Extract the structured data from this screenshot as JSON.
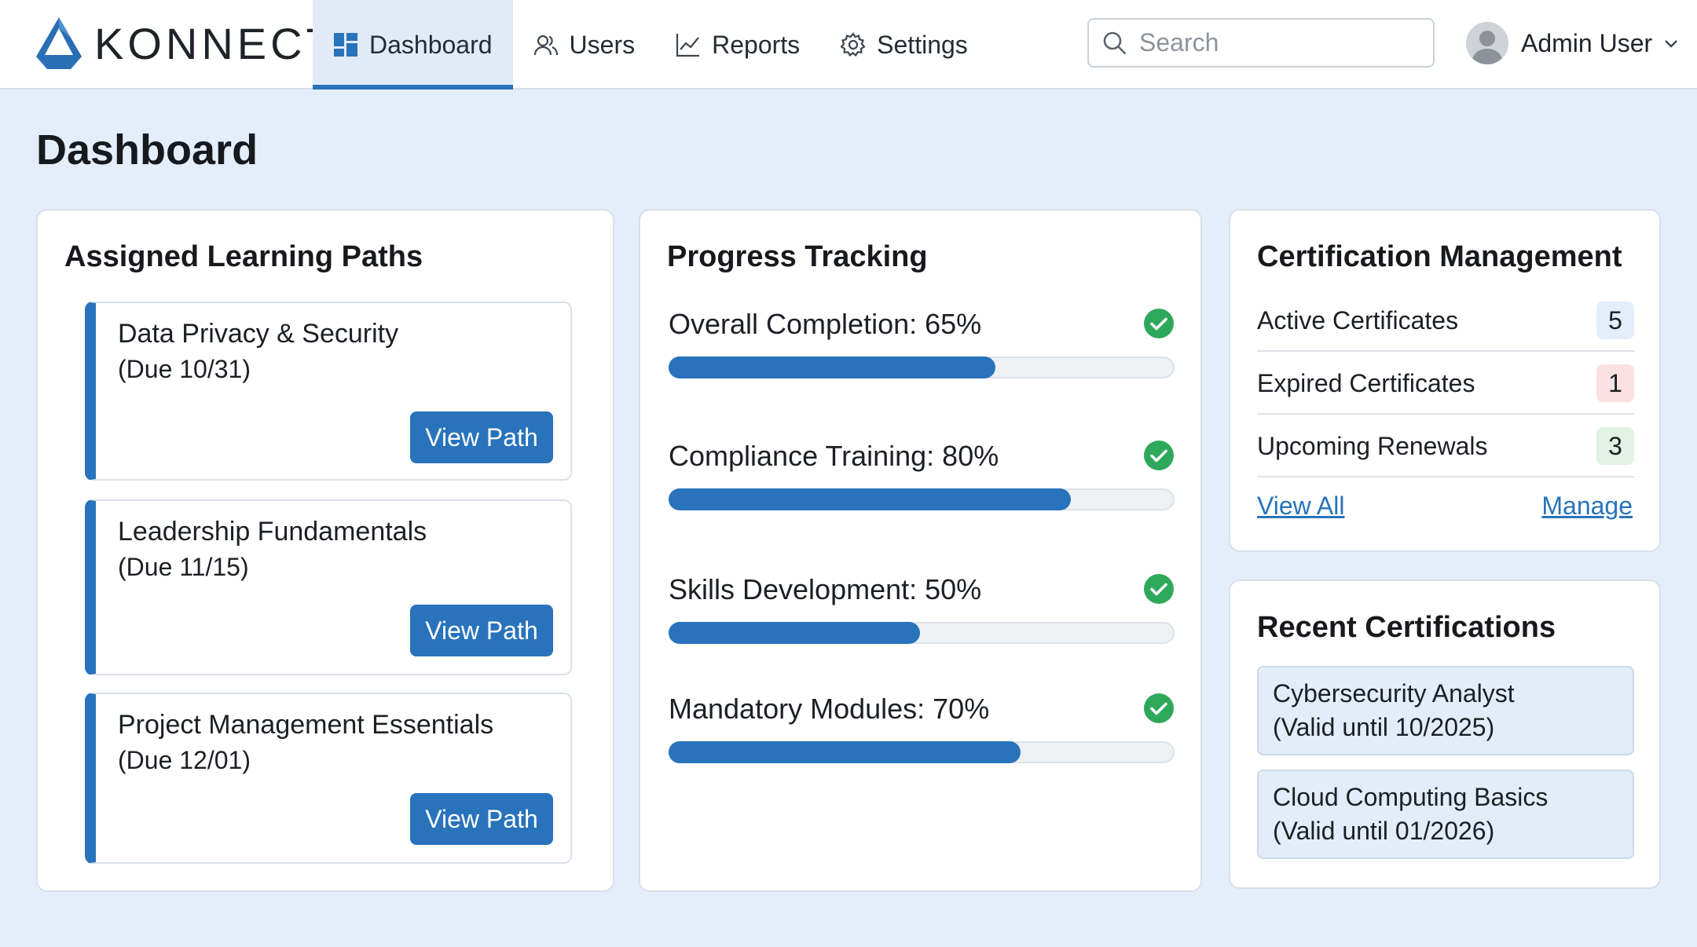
{
  "brand": {
    "name": "KONNECT"
  },
  "nav": {
    "items": [
      {
        "label": "Dashboard",
        "icon": "grid-icon",
        "active": true
      },
      {
        "label": "Users",
        "icon": "users-icon",
        "active": false
      },
      {
        "label": "Reports",
        "icon": "chart-line-icon",
        "active": false
      },
      {
        "label": "Settings",
        "icon": "gear-icon",
        "active": false
      }
    ]
  },
  "search": {
    "placeholder": "Search",
    "value": ""
  },
  "user": {
    "name": "Admin User"
  },
  "page": {
    "title": "Dashboard"
  },
  "learning_paths": {
    "title": "Assigned Learning Paths",
    "items": [
      {
        "name": "Data Privacy & Security",
        "due": "(Due 10/31)",
        "button": "View Path"
      },
      {
        "name": "Leadership Fundamentals",
        "due": "(Due 11/15)",
        "button": "View Path"
      },
      {
        "name": "Project Management Essentials",
        "due": "(Due 12/01)",
        "button": "View Path"
      }
    ]
  },
  "progress": {
    "title": "Progress Tracking",
    "items": [
      {
        "label": "Overall Completion: 65%",
        "percent": 65,
        "complete": true
      },
      {
        "label": "Compliance Training: 80%",
        "percent": 80,
        "complete": true
      },
      {
        "label": "Skills Development: 50%",
        "percent": 50,
        "complete": true
      },
      {
        "label": "Mandatory Modules: 70%",
        "percent": 70,
        "complete": true
      }
    ]
  },
  "cert_management": {
    "title": "Certification Management",
    "rows": [
      {
        "label": "Active Certificates",
        "count": "5",
        "badge_color": "#e3eefa"
      },
      {
        "label": "Expired Certificates",
        "count": "1",
        "badge_color": "#fbe1e1"
      },
      {
        "label": "Upcoming Renewals",
        "count": "3",
        "badge_color": "#e2f2e4"
      }
    ],
    "view_all": "View All",
    "manage": "Manage"
  },
  "recent_certs": {
    "title": "Recent Certifications",
    "items": [
      {
        "name": "Cybersecurity Analyst",
        "valid": "(Valid until 10/2025)"
      },
      {
        "name": "Cloud Computing Basics",
        "valid": "(Valid until 01/2026)"
      }
    ]
  },
  "colors": {
    "accent": "#2873bb",
    "success": "#2ea85a",
    "background": "#e4eefa"
  }
}
